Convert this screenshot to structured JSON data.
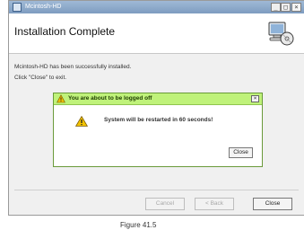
{
  "window": {
    "title": "Mcintosh-HD",
    "controls": {
      "minimize": "_",
      "maximize": "□",
      "close": "×"
    }
  },
  "installer": {
    "heading": "Installation Complete",
    "line1": "Mcintosh-HD has been successfully installed.",
    "line2": "Click \"Close\" to exit.",
    "header_art_icon": "computer-disk-icon"
  },
  "dialog": {
    "title": "You are about to be logged off",
    "message": "System will be restarted in 60 seconds!",
    "close_button": "Close",
    "title_icon": "warning-icon",
    "body_icon": "warning-icon"
  },
  "footer": {
    "cancel": "Cancel",
    "back": "< Back",
    "close": "Close"
  },
  "caption": "Figure 41.5",
  "colors": {
    "dialog_title_bg": "#bff27a",
    "warning_yellow": "#f2c200",
    "titlebar": "#8aa8cb"
  }
}
